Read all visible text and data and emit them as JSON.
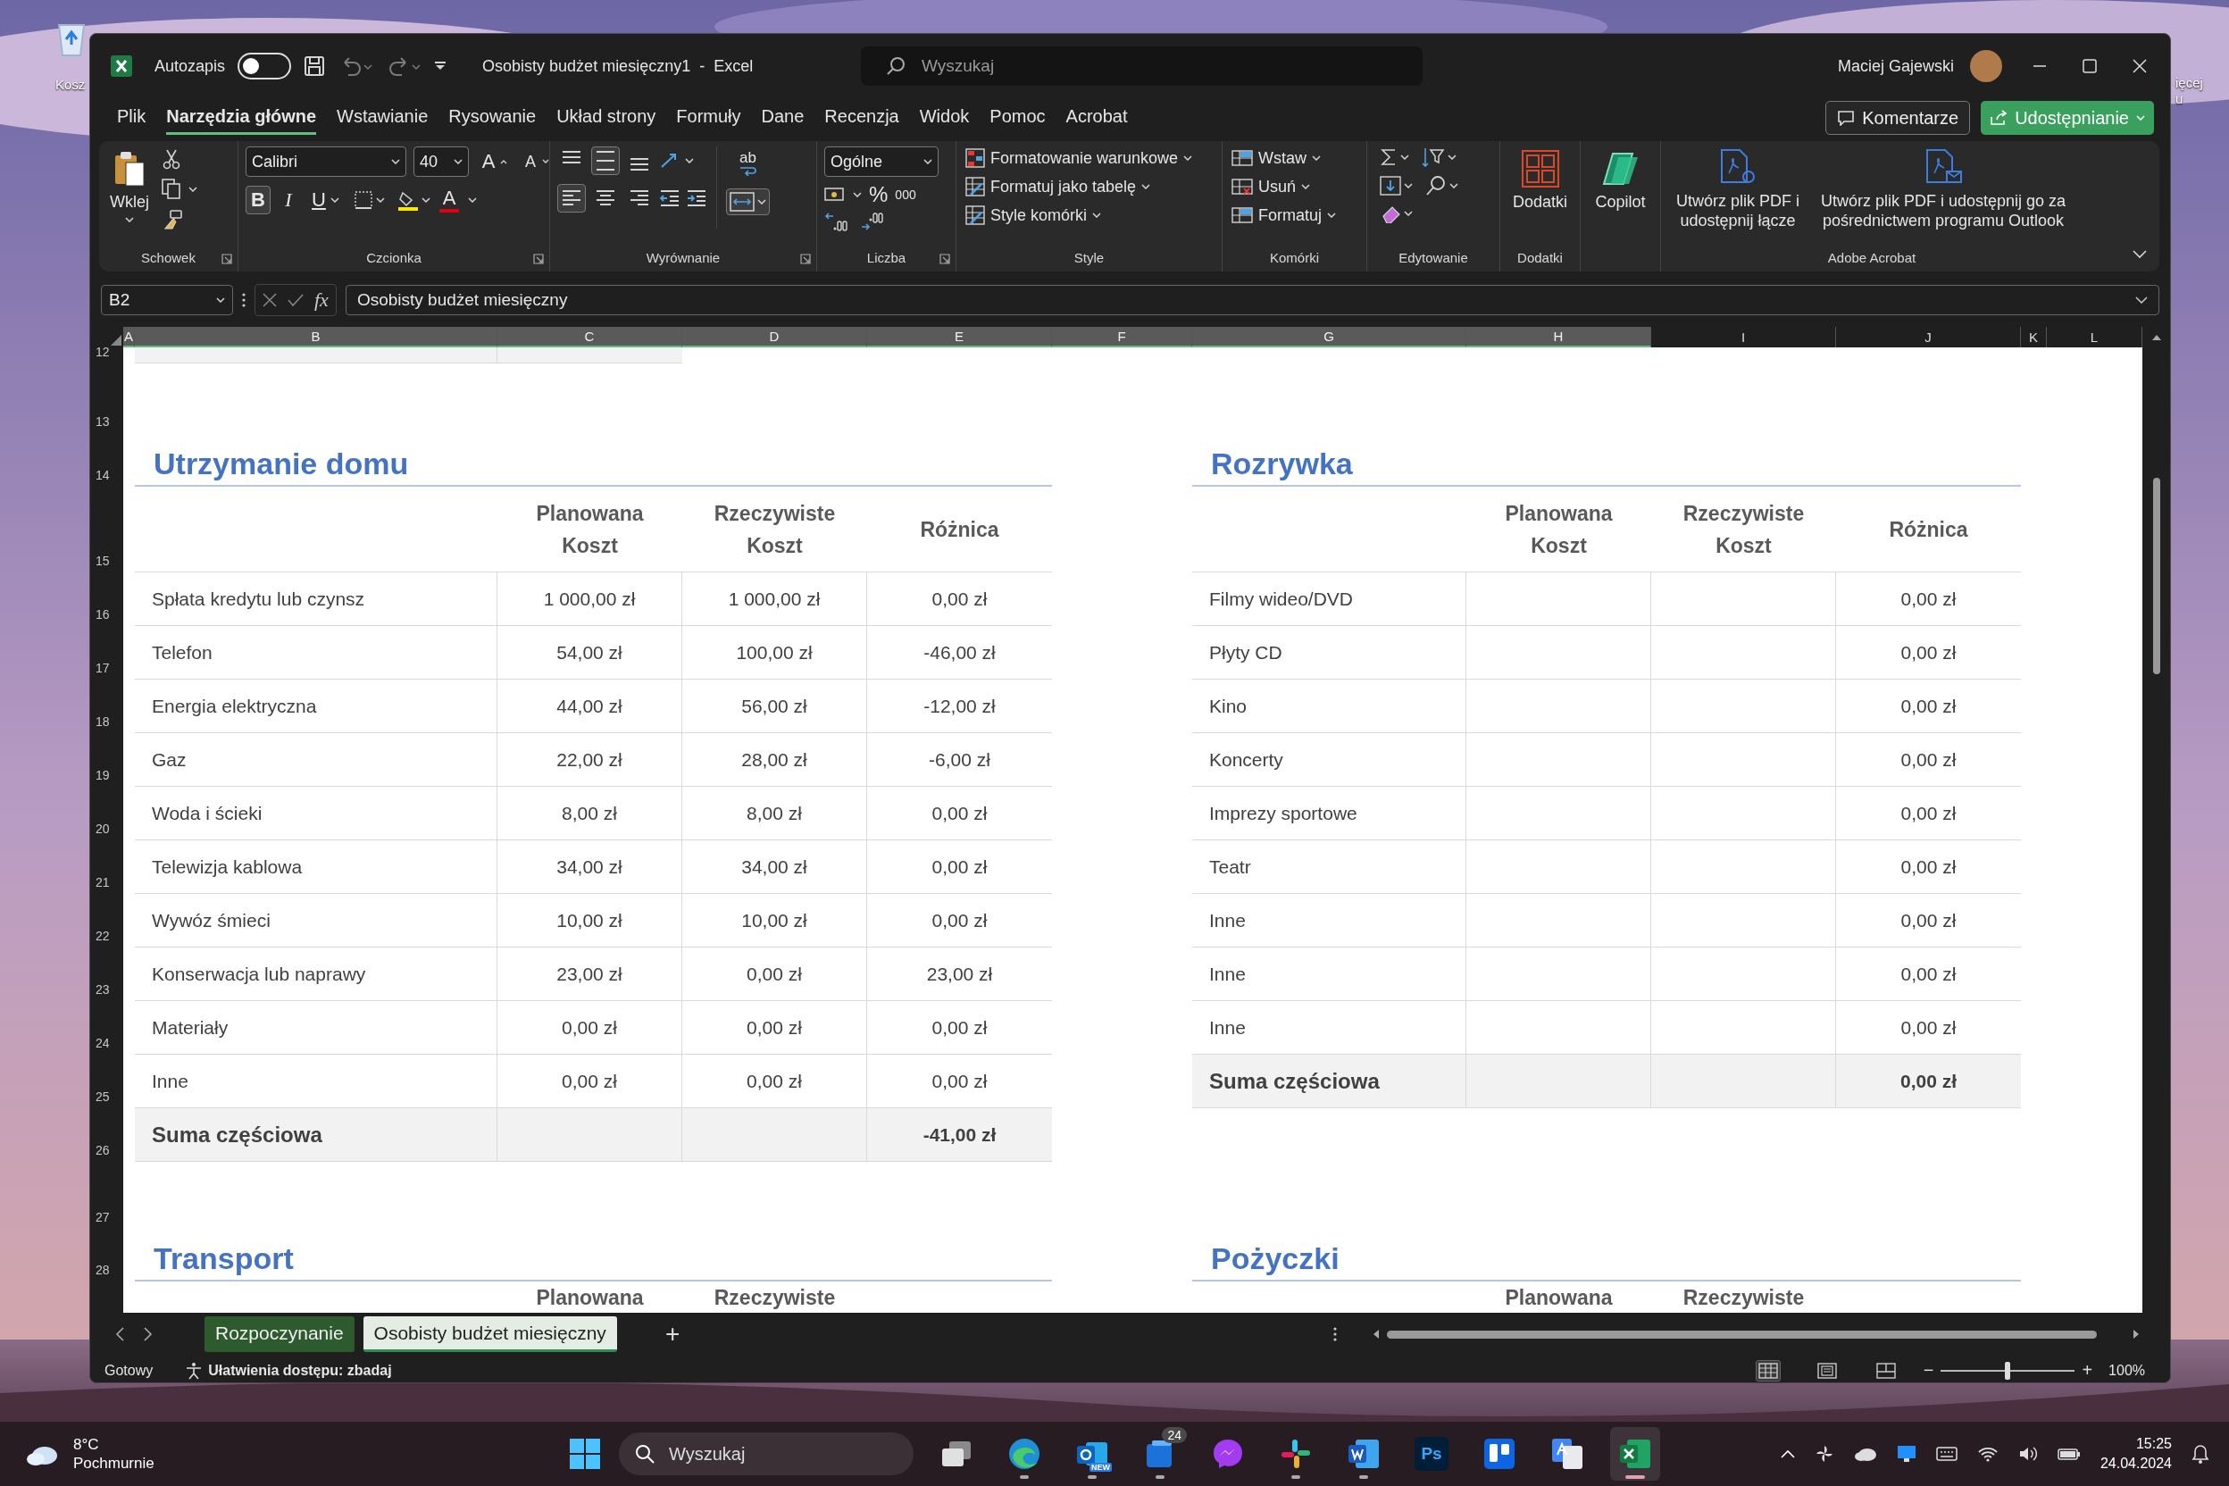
{
  "desktop": {
    "recycle_bin_label": "Kosz",
    "side_label_lines": [
      "ięcej",
      "u"
    ]
  },
  "window": {
    "autosave": {
      "label": "Autozapis",
      "on": false
    },
    "title": "Osobisty budżet miesięczny1  -  Excel",
    "search": {
      "placeholder": "Wyszukaj"
    },
    "user": {
      "name": "Maciej Gajewski"
    }
  },
  "ribbon_tabs": [
    {
      "label": "Plik",
      "selected": false
    },
    {
      "label": "Narzędzia główne",
      "selected": true
    },
    {
      "label": "Wstawianie",
      "selected": false
    },
    {
      "label": "Rysowanie",
      "selected": false
    },
    {
      "label": "Układ strony",
      "selected": false
    },
    {
      "label": "Formuły",
      "selected": false
    },
    {
      "label": "Dane",
      "selected": false
    },
    {
      "label": "Recenzja",
      "selected": false
    },
    {
      "label": "Widok",
      "selected": false
    },
    {
      "label": "Pomoc",
      "selected": false
    },
    {
      "label": "Acrobat",
      "selected": false
    }
  ],
  "ribbon_buttons": {
    "comments": "Komentarze",
    "share": "Udostępnianie"
  },
  "ribbon": {
    "clipboard": {
      "paste_label": "Wklej",
      "group_label": "Schowek"
    },
    "font": {
      "font_name": "Calibri",
      "font_size": "40",
      "grow_glyph": "A",
      "shrink_glyph": "A",
      "bold": {
        "glyph": "B",
        "selected": true
      },
      "italic": {
        "glyph": "I",
        "selected": false
      },
      "underline": {
        "glyph": "U",
        "selected": false
      },
      "font_color_glyph": "A",
      "group_label": "Czcionka"
    },
    "alignment": {
      "vertical": [
        {
          "kind": "top",
          "selected": false
        },
        {
          "kind": "middle",
          "selected": true
        },
        {
          "kind": "bottom",
          "selected": false
        }
      ],
      "wrap_glyph": "ab",
      "horizontal": [
        {
          "kind": "left",
          "selected": true
        },
        {
          "kind": "center",
          "selected": false
        },
        {
          "kind": "right",
          "selected": false
        }
      ],
      "merge_selected": true,
      "group_label": "Wyrównanie"
    },
    "number": {
      "format": "Ogólne",
      "percent_glyph": "%",
      "thousands_glyph": "000",
      "group_label": "Liczba"
    },
    "styles": {
      "items": [
        "Formatowanie warunkowe",
        "Formatuj jako tabelę",
        "Style komórki"
      ],
      "group_label": "Style"
    },
    "cells": {
      "items": [
        "Wstaw",
        "Usuń",
        "Formatuj"
      ],
      "group_label": "Komórki"
    },
    "editing": {
      "group_label": "Edytowanie"
    },
    "addins": {
      "label": "Dodatki",
      "group_label": "Dodatki"
    },
    "copilot": {
      "label": "Copilot"
    },
    "acrobat": {
      "items": [
        "Utwórz plik PDF i udostępnij łącze",
        "Utwórz plik PDF i udostępnij go za pośrednictwem programu Outlook"
      ],
      "group_label": "Adobe Acrobat"
    }
  },
  "formula_bar": {
    "name_box": "B2",
    "fx": "fx",
    "formula": "Osobisty budżet miesięczny"
  },
  "sheet": {
    "columns": [
      {
        "label": "A",
        "selected": true
      },
      {
        "label": "B",
        "selected": true
      },
      {
        "label": "C",
        "selected": true
      },
      {
        "label": "D",
        "selected": true
      },
      {
        "label": "E",
        "selected": true
      },
      {
        "label": "F",
        "selected": true
      },
      {
        "label": "G",
        "selected": true
      },
      {
        "label": "H",
        "selected": true
      },
      {
        "label": "I",
        "selected": false
      },
      {
        "label": "J",
        "selected": false
      },
      {
        "label": "K",
        "selected": false
      },
      {
        "label": "L",
        "selected": false
      }
    ],
    "rows": [
      "12",
      "13",
      "14",
      "15",
      "16",
      "17",
      "18",
      "19",
      "20",
      "21",
      "22",
      "23",
      "24",
      "25",
      "26",
      "27",
      "28"
    ],
    "tables": [
      {
        "title": "Utrzymanie domu",
        "headers": [
          "Planowana\nKoszt",
          "Rzeczywiste\nKoszt",
          "Różnica"
        ],
        "rows": [
          {
            "item": "Spłata kredytu lub czynsz",
            "planned": "1 000,00 zł",
            "actual": "1 000,00 zł",
            "difference": "0,00 zł"
          },
          {
            "item": "Telefon",
            "planned": "54,00 zł",
            "actual": "100,00 zł",
            "difference": "-46,00 zł"
          },
          {
            "item": "Energia elektryczna",
            "planned": "44,00 zł",
            "actual": "56,00 zł",
            "difference": "-12,00 zł"
          },
          {
            "item": "Gaz",
            "planned": "22,00 zł",
            "actual": "28,00 zł",
            "difference": "-6,00 zł"
          },
          {
            "item": "Woda i ścieki",
            "planned": "8,00 zł",
            "actual": "8,00 zł",
            "difference": "0,00 zł"
          },
          {
            "item": "Telewizja kablowa",
            "planned": "34,00 zł",
            "actual": "34,00 zł",
            "difference": "0,00 zł"
          },
          {
            "item": "Wywóz śmieci",
            "planned": "10,00 zł",
            "actual": "10,00 zł",
            "difference": "0,00 zł"
          },
          {
            "item": "Konserwacja lub naprawy",
            "planned": "23,00 zł",
            "actual": "0,00 zł",
            "difference": "23,00 zł"
          },
          {
            "item": "Materiały",
            "planned": "0,00 zł",
            "actual": "0,00 zł",
            "difference": "0,00 zł"
          },
          {
            "item": "Inne",
            "planned": "0,00 zł",
            "actual": "0,00 zł",
            "difference": "0,00 zł"
          }
        ],
        "subtotal": {
          "label": "Suma częściowa",
          "difference": "-41,00 zł"
        }
      },
      {
        "title": "Rozrywka",
        "headers": [
          "Planowana\nKoszt",
          "Rzeczywiste\nKoszt",
          "Różnica"
        ],
        "rows": [
          {
            "item": "Filmy wideo/DVD",
            "difference": "0,00 zł"
          },
          {
            "item": "Płyty CD",
            "difference": "0,00 zł"
          },
          {
            "item": "Kino",
            "difference": "0,00 zł"
          },
          {
            "item": "Koncerty",
            "difference": "0,00 zł"
          },
          {
            "item": "Imprezy sportowe",
            "difference": "0,00 zł"
          },
          {
            "item": "Teatr",
            "difference": "0,00 zł"
          },
          {
            "item": "Inne",
            "difference": "0,00 zł"
          },
          {
            "item": "Inne",
            "difference": "0,00 zł"
          },
          {
            "item": "Inne",
            "difference": "0,00 zł"
          }
        ],
        "subtotal": {
          "label": "Suma częściowa",
          "difference": "0,00 zł"
        }
      },
      {
        "title": "Transport",
        "headers": [
          "Planowana",
          "Rzeczywiste"
        ]
      },
      {
        "title": "Pożyczki",
        "headers": [
          "Planowana",
          "Rzeczywiste"
        ]
      }
    ]
  },
  "sheet_tabs": [
    {
      "label": "Rozpoczynanie",
      "selected": false,
      "color": "#2e5b2e"
    },
    {
      "label": "Osobisty budżet miesięczny",
      "selected": true
    }
  ],
  "add_sheet": "+",
  "status_bar": {
    "ready": "Gotowy",
    "accessibility": "Ułatwienia dostępu: zbadaj",
    "views": [
      {
        "kind": "normal",
        "selected": true
      },
      {
        "kind": "page_layout",
        "selected": false
      },
      {
        "kind": "page_break",
        "selected": false
      }
    ],
    "zoom": {
      "minus": "−",
      "plus": "+",
      "level": 0.5,
      "reading": "100%"
    }
  },
  "taskbar": {
    "weather": {
      "temperature": "8°C",
      "condition": "Pochmurnie"
    },
    "search": {
      "placeholder": "Wyszukaj"
    },
    "apps": [
      {
        "kind": "taskview",
        "running": false,
        "selected": false
      },
      {
        "kind": "edge",
        "running": true,
        "selected": false
      },
      {
        "kind": "outlook",
        "tag": "NEW",
        "running": true,
        "selected": false
      },
      {
        "kind": "teams",
        "badge": "24",
        "running": true,
        "selected": false
      },
      {
        "kind": "messenger",
        "running": false,
        "selected": false
      },
      {
        "kind": "slack",
        "running": true,
        "selected": false
      },
      {
        "kind": "word",
        "running": true,
        "selected": false
      },
      {
        "kind": "photoshop",
        "glyph": "Ps",
        "running": false,
        "selected": false
      },
      {
        "kind": "trello",
        "running": false,
        "selected": false
      },
      {
        "kind": "translate",
        "running": false,
        "selected": false
      },
      {
        "kind": "excel",
        "running": true,
        "selected": true
      }
    ],
    "clock": {
      "time": "15:25",
      "date": "24.04.2024"
    }
  }
}
